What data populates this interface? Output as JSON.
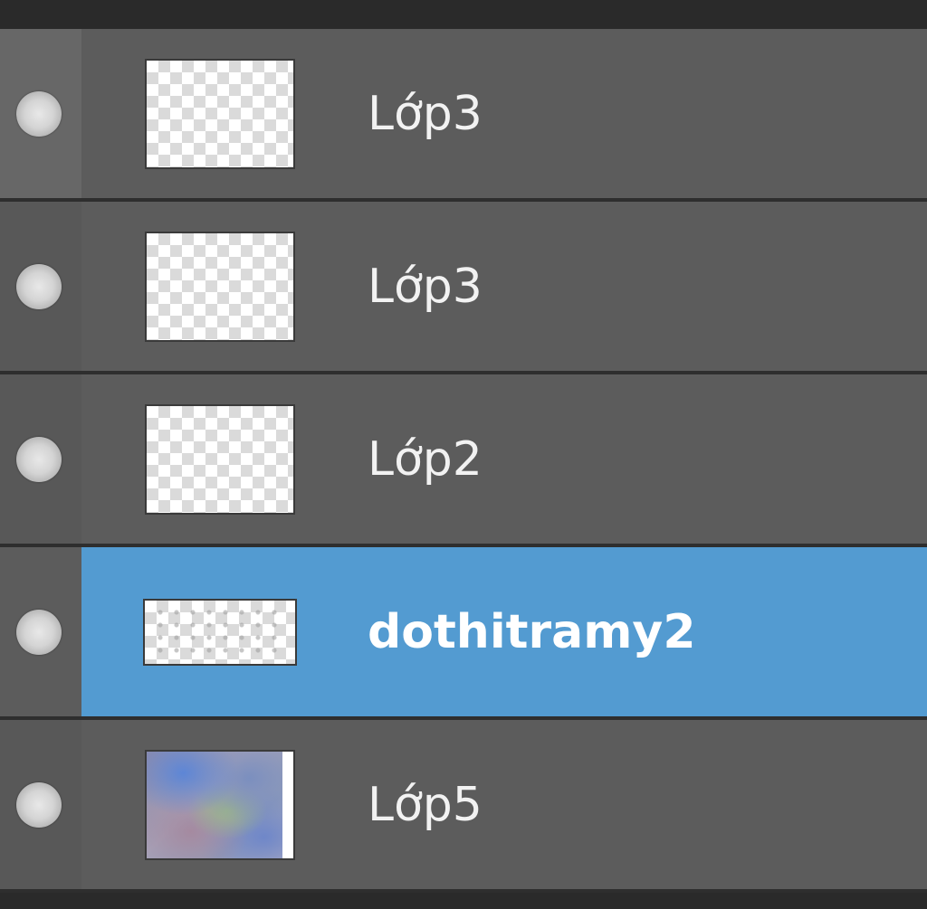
{
  "layers_panel": {
    "layers": [
      {
        "name": "Lớp3",
        "selected": false,
        "thumbnail": "transparent",
        "visibility_icon": "visibility-dot-icon"
      },
      {
        "name": "Lớp3",
        "selected": false,
        "thumbnail": "transparent",
        "visibility_icon": "visibility-dot-icon"
      },
      {
        "name": "Lớp2",
        "selected": false,
        "thumbnail": "transparent",
        "visibility_icon": "visibility-dot-icon"
      },
      {
        "name": "dothitramy2",
        "selected": true,
        "thumbnail": "transparent-wide",
        "visibility_icon": "visibility-dot-icon"
      },
      {
        "name": "Lớp5",
        "selected": false,
        "thumbnail": "photo",
        "visibility_icon": "visibility-dot-icon"
      }
    ],
    "colors": {
      "row_background": "#5c5c5c",
      "selected_background": "#539bd1",
      "separator": "#2e2e2e",
      "text": "#f2f2f2"
    }
  }
}
